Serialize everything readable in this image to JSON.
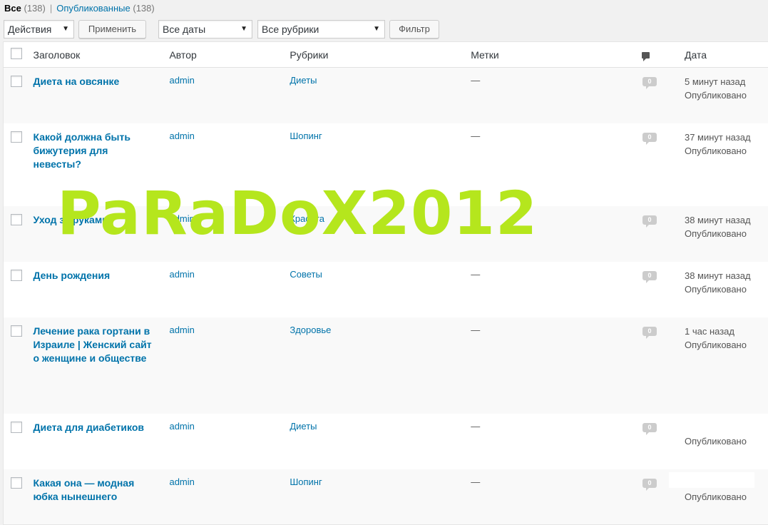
{
  "filters_nav": {
    "all_label": "Все",
    "all_count": "(138)",
    "separator": "|",
    "published_label": "Опубликованные",
    "published_count": "(138)"
  },
  "tablenav": {
    "bulk_actions": "Действия",
    "apply_button": "Применить",
    "dates_select": "Все даты",
    "categories_select": "Все рубрики",
    "filter_button": "Фильтр"
  },
  "table": {
    "headers": {
      "title": "Заголовок",
      "author": "Автор",
      "categories": "Рубрики",
      "tags": "Метки",
      "date": "Дата"
    },
    "rows": [
      {
        "title": "Диета на овсянке",
        "author": "admin",
        "category": "Диеты",
        "tags": "—",
        "comments": "0",
        "date": "5 минут назад",
        "status": "Опубликовано"
      },
      {
        "title": "Какой должна быть бижутерия для невесты?",
        "author": "admin",
        "category": "Шопинг",
        "tags": "—",
        "comments": "0",
        "date": "37 минут назад",
        "status": "Опубликовано"
      },
      {
        "title": "Уход за руками",
        "author": "admin",
        "category": "Красота",
        "tags": "—",
        "comments": "0",
        "date": "38 минут назад",
        "status": "Опубликовано"
      },
      {
        "title": "День рождения",
        "author": "admin",
        "category": "Советы",
        "tags": "—",
        "comments": "0",
        "date": "38 минут назад",
        "status": "Опубликовано"
      },
      {
        "title": "Лечение рака гортани в Израиле | Женский сайт о женщине и обществе",
        "author": "admin",
        "category": "Здоровье",
        "tags": "—",
        "comments": "0",
        "date": "1 час назад",
        "status": "Опубликовано"
      },
      {
        "title": "Диета для диабетиков",
        "author": "admin",
        "category": "Диеты",
        "tags": "—",
        "comments": "0",
        "date": "",
        "status": "Опубликовано"
      },
      {
        "title": "Какая она — модная юбка нынешнего",
        "author": "admin",
        "category": "Шопинг",
        "tags": "—",
        "comments": "0",
        "date": "",
        "status": "Опубликовано"
      }
    ]
  },
  "watermark": "PaRaDoX2012",
  "colors": {
    "link": "#0073aa",
    "watermark": "#b5e61d",
    "bubble": "#cccccc",
    "row_alt": "#f9f9f9"
  }
}
